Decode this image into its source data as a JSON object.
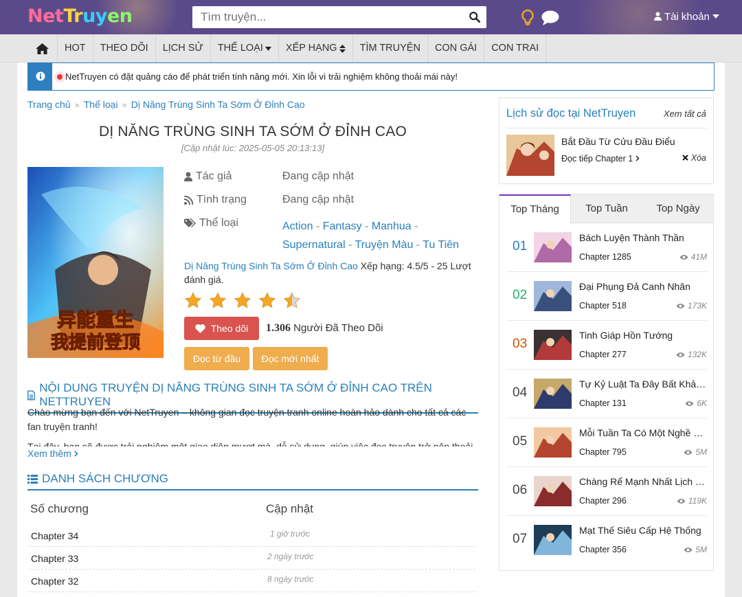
{
  "header": {
    "logo": "NetTruyen",
    "search_placeholder": "Tìm truyện...",
    "account_label": "Tài khoản"
  },
  "nav": {
    "items": [
      "HOT",
      "THEO DÕI",
      "LỊCH SỬ",
      "THỂ LOẠI",
      "XẾP HẠNG",
      "TÌM TRUYỆN",
      "CON GÁI",
      "CON TRAI"
    ]
  },
  "notice": "NetTruyen có đặt quảng cáo để phát triển tính năng mới. Xin lỗi vì trải nghiệm không thoải mái này!",
  "breadcrumb": [
    "Trang chủ",
    "Thể loại",
    "Dị Năng Trùng Sinh Ta Sớm Ở Đỉnh Cao"
  ],
  "manga": {
    "title": "DỊ NĂNG TRÙNG SINH TA SỚM Ở ĐỈNH CAO",
    "updated": "[Cập nhật lúc: 2025-05-05 20:13:13]",
    "author_label": "Tác giả",
    "author": "Đang cập nhật",
    "status_label": "Tình trạng",
    "status": "Đang cập nhật",
    "genre_label": "Thể loại",
    "genres": [
      "Action",
      "Fantasy",
      "Manhua",
      "Supernatural",
      "Truyện Màu",
      "Tu Tiên"
    ],
    "rating_link": "Dị Năng Trùng Sinh Ta Sớm Ở Đỉnh Cao",
    "rating_text": "Xếp hạng: 4.5/5 - 25 Lượt đánh giá.",
    "rating_value": 4.5,
    "follow_label": "Theo dõi",
    "follow_count": "1.306",
    "follow_suffix": "Người Đã Theo Dõi",
    "read_first": "Đọc từ đầu",
    "read_latest": "Đọc mới nhất"
  },
  "content": {
    "heading": "NỘI DUNG TRUYỆN DỊ NĂNG TRÙNG SINH TA SỚM Ở ĐỈNH CAO TRÊN NETTRUYEN",
    "p1": "Chào mừng bạn đến với NetTruyen – không gian đọc truyện tranh online hoàn hảo dành cho tất cả các fan truyện tranh!",
    "p2": "Tại đây, bạn sẽ được trải nghiệm một giao diện mượt mà, dễ sử dụng, giúp việc đọc truyện trở nên thoải",
    "more": "Xem thêm"
  },
  "chapters": {
    "heading": "DANH SÁCH CHƯƠNG",
    "col_num": "Số chương",
    "col_update": "Cập nhật",
    "rows": [
      {
        "name": "Chapter 34",
        "time": "1 giờ trước"
      },
      {
        "name": "Chapter 33",
        "time": "2 ngày trước"
      },
      {
        "name": "Chapter 32",
        "time": "8 ngày trước"
      }
    ]
  },
  "history": {
    "title": "Lịch sử đọc tại NetTruyen",
    "see_all": "Xem tất cả",
    "item_name": "Bắt Đầu Từ Cửu Đầu Điểu",
    "continue": "Đọc tiếp Chapter 1",
    "delete": "Xóa"
  },
  "top": {
    "tabs": [
      "Top Tháng",
      "Top Tuần",
      "Top Ngày"
    ],
    "items": [
      {
        "rank": "01",
        "color": "#2980b9",
        "name": "Bách Luyện Thành Thần",
        "chapter": "Chapter 1285",
        "views": "41M"
      },
      {
        "rank": "02",
        "color": "#27ae60",
        "name": "Đại Phụng Đả Canh Nhân",
        "chapter": "Chapter 518",
        "views": "173K"
      },
      {
        "rank": "03",
        "color": "#d35400",
        "name": "Tinh Giáp Hồn Tướng",
        "chapter": "Chapter 277",
        "views": "132K"
      },
      {
        "rank": "04",
        "color": "#444444",
        "name": "Tự Kỷ Luật Ta Đây Bất Khả Chiến Bại",
        "chapter": "Chapter 131",
        "views": "6K"
      },
      {
        "rank": "05",
        "color": "#444444",
        "name": "Mỗi Tuần Ta Có Một Nghề Nghiệp Mới",
        "chapter": "Chapter 795",
        "views": "5M"
      },
      {
        "rank": "06",
        "color": "#444444",
        "name": "Chàng Rể Mạnh Nhất Lịch Sử",
        "chapter": "Chapter 296",
        "views": "119K"
      },
      {
        "rank": "07",
        "color": "#444444",
        "name": "Mạt Thế Siêu Cấp Hệ Thống",
        "chapter": "Chapter 356",
        "views": "5M"
      }
    ]
  }
}
